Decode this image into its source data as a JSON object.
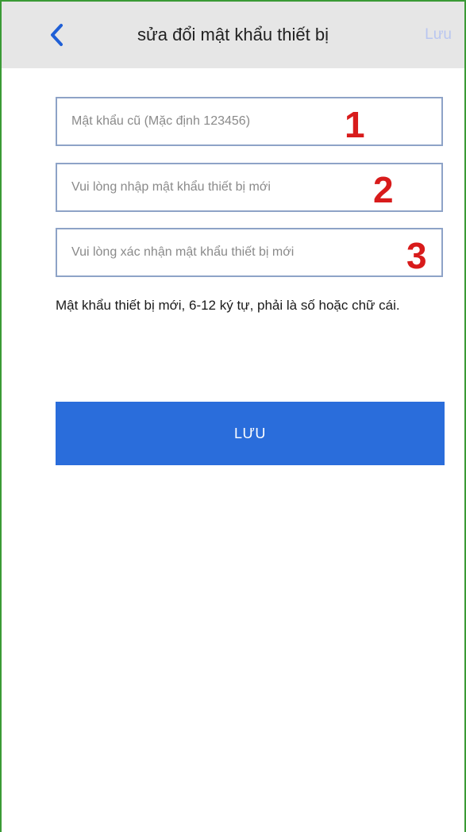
{
  "header": {
    "back_icon": "chevron-left-icon",
    "title": "sửa đổi mật khẩu thiết bị",
    "save_label": "Lưu"
  },
  "form": {
    "old_password": {
      "value": "",
      "placeholder": "Mật khẩu cũ (Mặc định 123456)",
      "marker": "1"
    },
    "new_password": {
      "value": "",
      "placeholder": "Vui lòng nhập mật khẩu thiết bị mới",
      "marker": "2"
    },
    "confirm_password": {
      "value": "",
      "placeholder": "Vui lòng xác nhận mật khẩu thiết bị mới",
      "marker": "3"
    },
    "hint": "Mật khẩu thiết bị mới, 6-12 ký tự, phải là số hoặc chữ cái.",
    "submit_label": "LƯU"
  },
  "colors": {
    "header_bg": "#e6e6e6",
    "accent_blue": "#2a6ddb",
    "back_icon": "#1f5fd6",
    "marker_red": "#d81b1b",
    "field_border": "#8ea3c7",
    "frame_border": "#3a9a35"
  }
}
